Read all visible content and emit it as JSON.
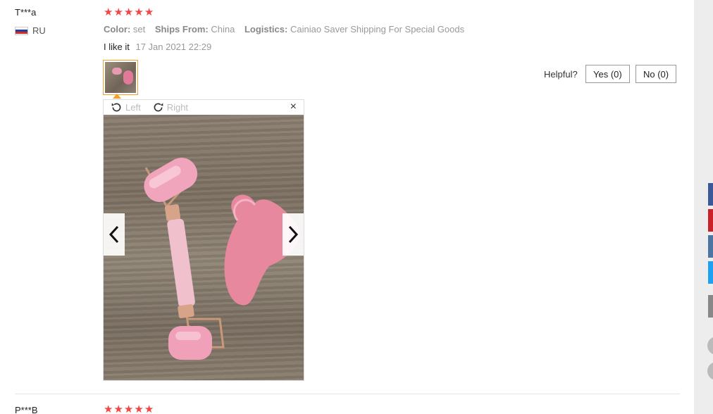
{
  "review": {
    "user_name": "T***a",
    "country": "RU",
    "rating": 5,
    "stars": [
      "★",
      "★",
      "★",
      "★",
      "★"
    ],
    "attributes": {
      "color_label": "Color:",
      "color_value": "set",
      "ships_label": "Ships From:",
      "ships_value": "China",
      "logistics_label": "Logistics:",
      "logistics_value": "Cainiao Saver Shipping For Special Goods"
    },
    "feedback": "I like it",
    "date": "17 Jan 2021 22:29",
    "helpful": {
      "label": "Helpful?",
      "yes_label": "Yes (0)",
      "no_label": "No (0)"
    },
    "viewer": {
      "rotate_left_label": "Left",
      "rotate_right_label": "Right",
      "close_symbol": "×"
    }
  },
  "next_review": {
    "user_name": "P***B",
    "stars": [
      "★",
      "★",
      "★",
      "★",
      "★"
    ]
  },
  "colors": {
    "star": "#f44545",
    "thumb_border": "#f0a030",
    "facebook": "#3b5998",
    "pinterest": "#cb2027",
    "vk": "#4c75a3",
    "twitter": "#1da1f2"
  }
}
